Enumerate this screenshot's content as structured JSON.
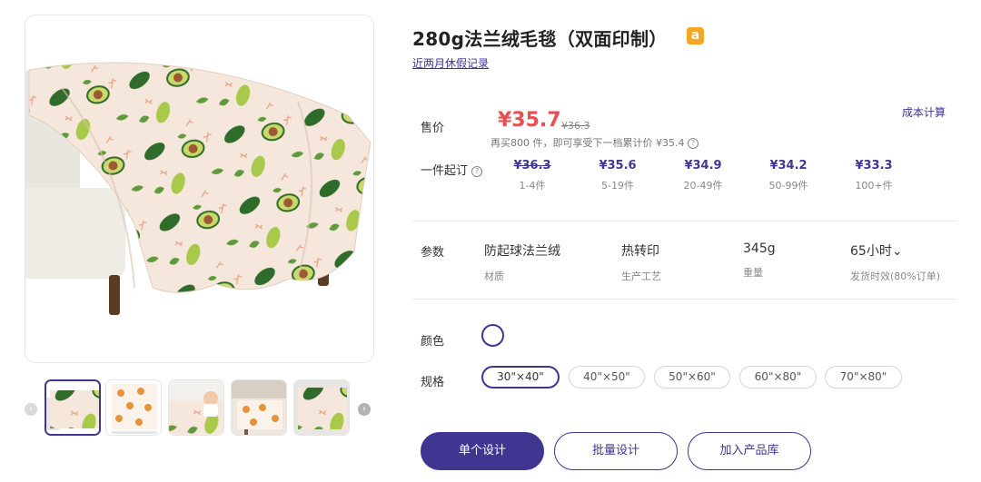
{
  "product": {
    "title": "280g法兰绒毛毯（双面印制）",
    "marketplace_badge": "a",
    "holiday_link": "近两月休假记录"
  },
  "pricing": {
    "cost_calc_link": "成本计算",
    "price_label": "售价",
    "current_price": "¥35.7",
    "original_price": "¥36.3",
    "tier_note": "再买800 件，即可享受下一档累计价 ¥35.4",
    "moq_label": "一件起订",
    "tiers": [
      {
        "price": "¥36.3",
        "qty": "1-4件"
      },
      {
        "price": "¥35.6",
        "qty": "5-19件"
      },
      {
        "price": "¥34.9",
        "qty": "20-49件"
      },
      {
        "price": "¥34.2",
        "qty": "50-99件"
      },
      {
        "price": "¥33.3",
        "qty": "100+件"
      }
    ]
  },
  "params": {
    "label": "参数",
    "items": [
      {
        "value": "防起球法兰绒",
        "label": "材质"
      },
      {
        "value": "热转印",
        "label": "生产工艺"
      },
      {
        "value": "345g",
        "label": "重量"
      },
      {
        "value": "65小时⌄",
        "label": "发货时效(80%订单)"
      }
    ]
  },
  "options": {
    "color_label": "颜色",
    "size_label": "规格",
    "sizes": [
      "30\"×40\"",
      "40\"×50\"",
      "50\"×60\"",
      "60\"×80\"",
      "70\"×80\""
    ],
    "selected_size": "30\"×40\""
  },
  "actions": {
    "single_design": "单个设计",
    "batch_design": "批量设计",
    "add_to_library": "加入产品库"
  },
  "gallery": {
    "prev_icon": "chevron-left-icon",
    "next_icon": "chevron-right-icon",
    "thumbnail_count": 5,
    "active_thumbnail": 1
  },
  "colors": {
    "brand": "#3f3691",
    "price_red": "#e94f4f",
    "amazon_orange": "#f5a623",
    "blanket_bg": "#f6e7dc",
    "avocado_dark": "#2f6b2a",
    "avocado_light": "#a9c94a",
    "avocado_pit": "#9c5a32"
  }
}
